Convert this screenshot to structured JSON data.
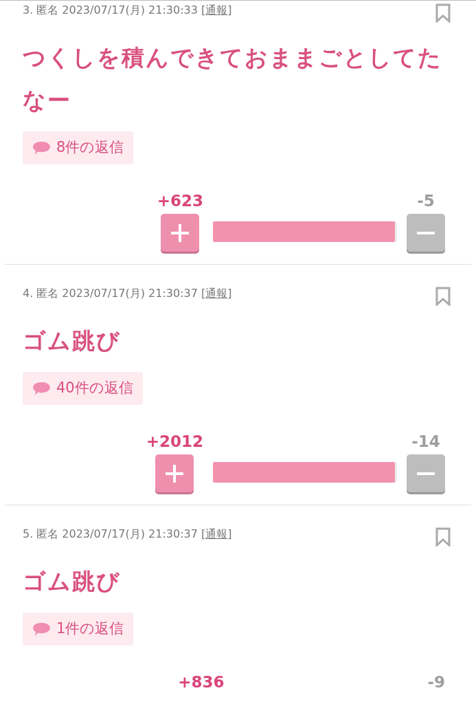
{
  "posts": [
    {
      "number": "3.",
      "author": "匿名",
      "timestamp": "2023/07/17(月) 21:30:33",
      "report_open": "[",
      "report_link": "通報",
      "report_close": "]",
      "title": "つくしを積んできておままごとしてたなー",
      "replies": "8件の返信",
      "plus_score": "+623",
      "minus_score": "-5",
      "level": 0.99
    },
    {
      "number": "4.",
      "author": "匿名",
      "timestamp": "2023/07/17(月) 21:30:37",
      "report_open": "[",
      "report_link": "通報",
      "report_close": "]",
      "title": "ゴム跳び",
      "replies": "40件の返信",
      "plus_score": "+2012",
      "minus_score": "-14",
      "level": 0.99
    },
    {
      "number": "5.",
      "author": "匿名",
      "timestamp": "2023/07/17(月) 21:30:37",
      "report_open": "[",
      "report_link": "通報",
      "report_close": "]",
      "title": "ゴム跳び",
      "replies": "1件の返信",
      "plus_score": "+836",
      "minus_score": "-9"
    }
  ]
}
